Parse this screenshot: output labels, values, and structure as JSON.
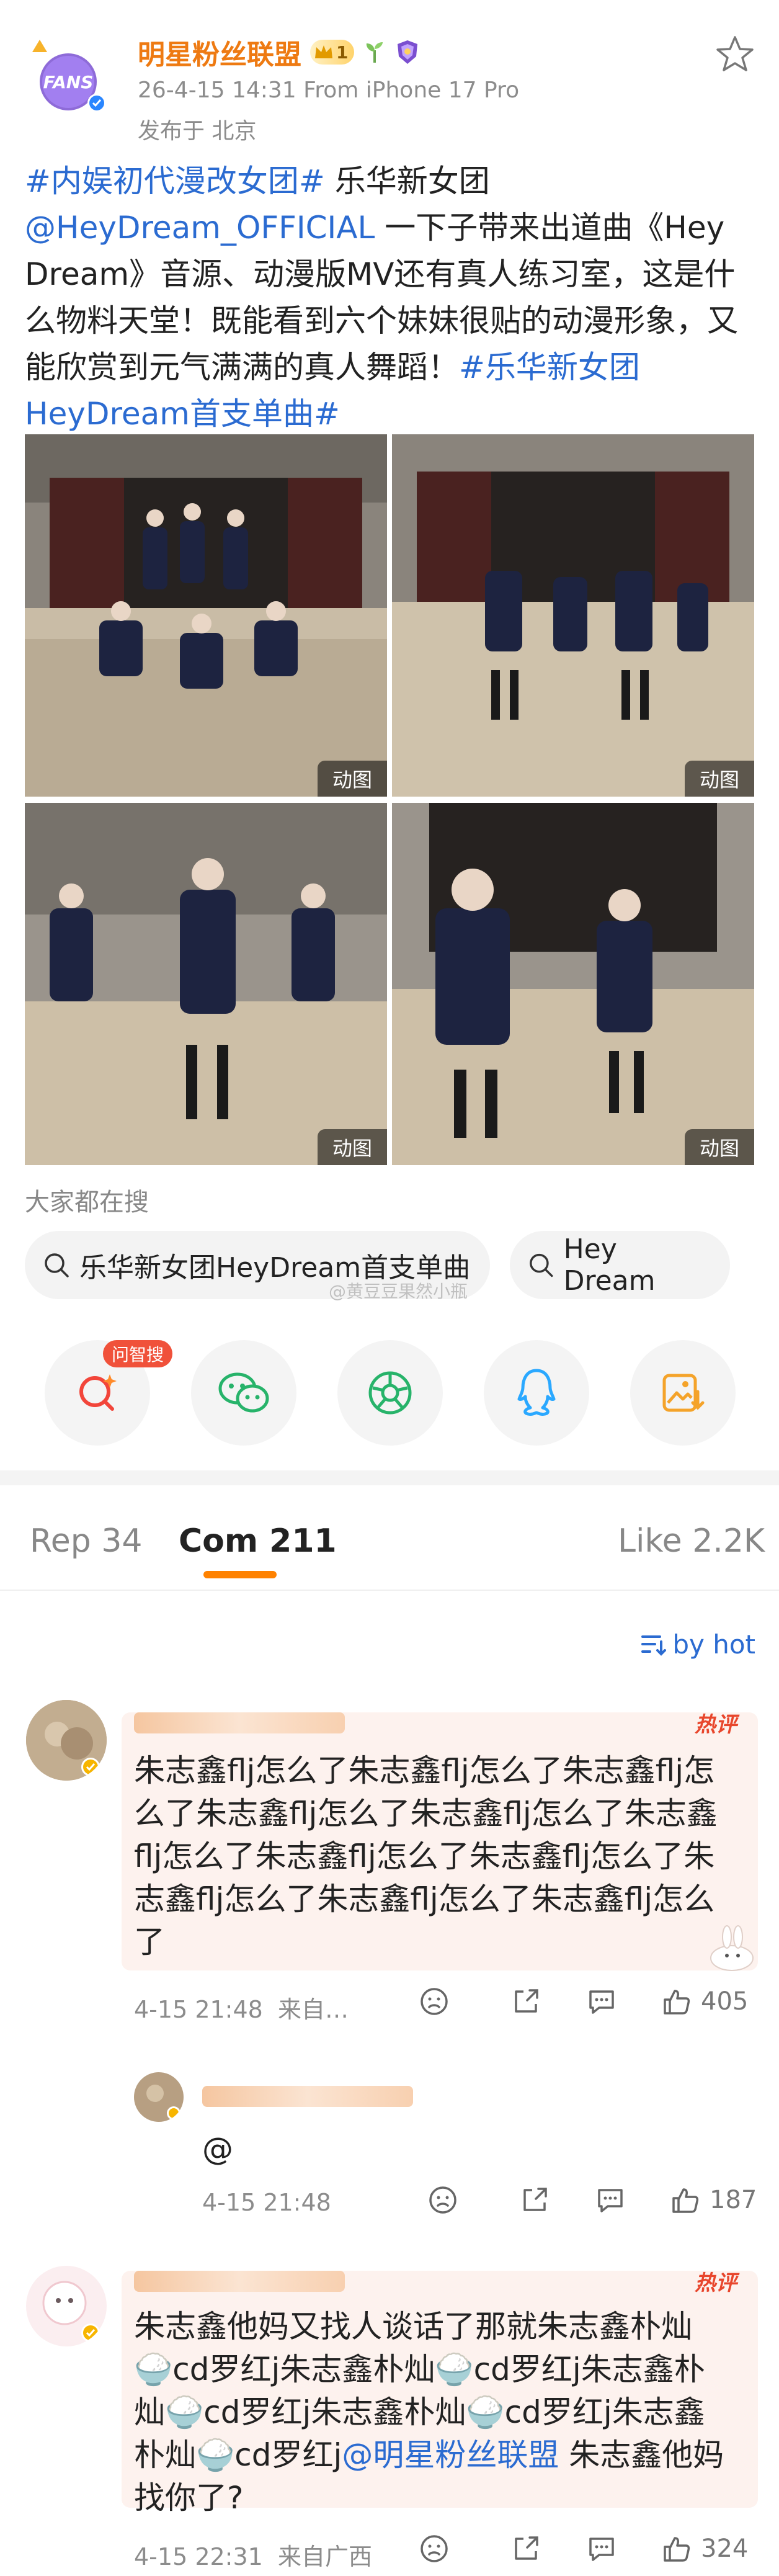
{
  "post": {
    "author": "明星粉丝联盟",
    "vip_level": "1",
    "time_source": "26-4-15 14:31  From iPhone 17 Pro",
    "location": "发布于 北京",
    "text_parts": [
      {
        "t": "#内娱初代漫改女团#",
        "link": true
      },
      {
        "t": " 乐华新女团",
        "link": false
      },
      {
        "t": "@HeyDream_OFFICIAL",
        "link": true
      },
      {
        "t": " 一下子带来出道曲《Hey Dream》音源、动漫版MV还有真人练习室，这是什么物料天堂！既能看到六个妹妹很贴的动漫形象，又能欣赏到元气满满的真人舞蹈！",
        "link": false
      },
      {
        "t": "#乐华新女团HeyDream首支单曲#",
        "link": true
      }
    ],
    "images": [
      {
        "tag": "动图"
      },
      {
        "tag": "动图"
      },
      {
        "tag": "动图"
      },
      {
        "tag": "动图"
      }
    ]
  },
  "search": {
    "title": "大家都在搜",
    "chips": [
      "乐华新女团HeyDream首支单曲",
      "Hey Dream"
    ],
    "watermark": "@黄豆豆果然小瓶"
  },
  "share": {
    "ask_badge": "问智搜"
  },
  "tabs": {
    "repost": "Rep 34",
    "comments": "Com 211",
    "likes": "Like 2.2K"
  },
  "sort": {
    "label": "by hot"
  },
  "comments": [
    {
      "hot_label": "热评",
      "text": "朱志鑫flj怎么了朱志鑫flj怎么了朱志鑫flj怎么了朱志鑫flj怎么了朱志鑫flj怎么了朱志鑫flj怎么了朱志鑫flj怎么了朱志鑫flj怎么了朱志鑫flj怎么了朱志鑫flj怎么了朱志鑫flj怎么了",
      "time": "4-15 21:48",
      "source": "来自…",
      "likes": "405"
    },
    {
      "text": "@",
      "time": "4-15 21:48",
      "likes": "187"
    },
    {
      "hot_label": "热评",
      "text_a": "朱志鑫他妈又找人谈话了那就朱志鑫朴灿🍚cd罗红j朱志鑫朴灿🍚cd罗红j朱志鑫朴灿🍚cd罗红j朱志鑫朴灿🍚cd罗红j朱志鑫朴灿🍚cd罗红j",
      "mention": "@明星粉丝联盟",
      "text_b": " 朱志鑫他妈找你了?",
      "time": "4-15 22:31",
      "source": "来自广西",
      "likes": "324"
    }
  ],
  "colors": {
    "accent": "#ff8200",
    "link": "#2b6bd1",
    "hot": "#e8462c",
    "author": "#ee7a12"
  }
}
